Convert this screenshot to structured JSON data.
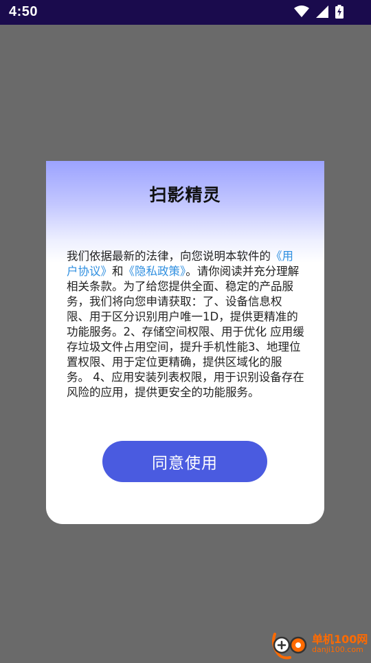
{
  "status_bar": {
    "time": "4:50"
  },
  "dialog": {
    "title": "扫影精灵",
    "body_intro": "我们依据最新的法律，向您说明本软件的",
    "link_user_agreement": "《用户协议》",
    "conjunction": "和",
    "link_privacy_policy": "《隐私政策》",
    "body_rest": "。请你阅读并充分理解相关条款。为了给您提供全面、稳定的产品服务，我们将向您申请获取：了、设备信息权限、用于区分识别用户唯一1D，提供更精准的功能服务。2、存储空间权限、用于优化 应用缓存垃圾文件占用空间，提升手机性能3、地理位置权限、用于定位更精确，提供区域化的服务。 4、应用安装列表权限，用于识别设备存在风险的应用，提供更安全的功能服务。",
    "agree_button": "同意使用"
  },
  "watermark": {
    "name": "单机100网",
    "url": "danji100.com"
  },
  "colors": {
    "status_bar_bg": "#1a0b4d",
    "overlay_bg": "#6a6a6a",
    "button_bg": "#4a5be0",
    "link": "#2f8fe0",
    "header_gradient_top": "#9ca3ff"
  },
  "icons": {
    "wifi": "wifi-icon",
    "signal": "signal-icon",
    "battery": "battery-charging-icon"
  }
}
